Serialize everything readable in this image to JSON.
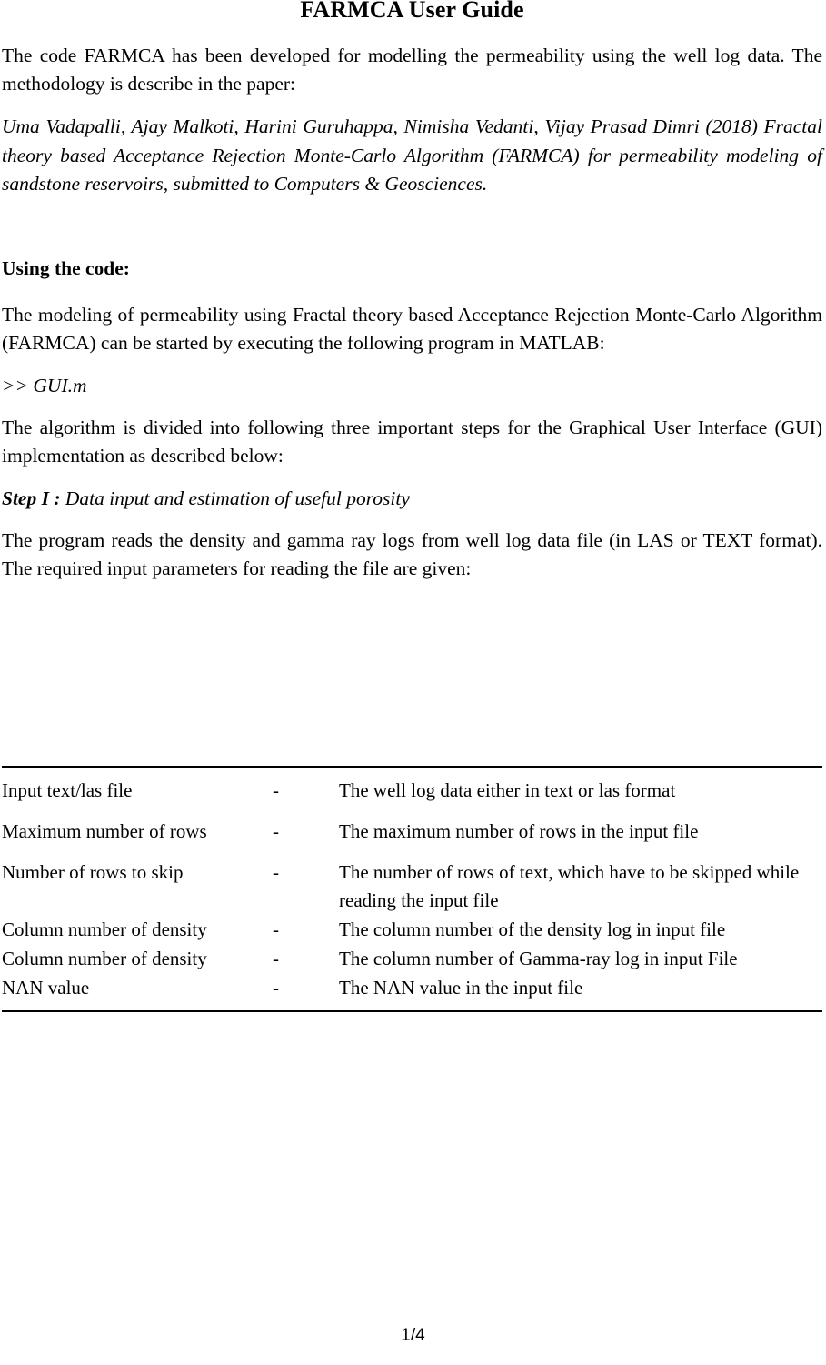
{
  "document": {
    "title": "FARMCA User Guide",
    "page_number": "1/4"
  },
  "intro": {
    "paragraph": "The code FARMCA has been developed for modelling the permeability using the well log data. The methodology is describe in the paper:"
  },
  "citation": {
    "text": "Uma Vadapalli, Ajay Malkoti, Harini Guruhappa, Nimisha Vedanti, Vijay Prasad Dimri (2018) Fractal theory based Acceptance Rejection Monte-Carlo Algorithm (FARMCA) for permeability modeling of sandstone reservoirs, submitted to Computers & Geosciences."
  },
  "using_the_code": {
    "heading": "Using the code:",
    "paragraph": "The modeling of permeability using Fractal theory based Acceptance Rejection Monte-Carlo Algorithm (FARMCA) can be started by executing the following program in MATLAB:",
    "command": ">> GUI.m",
    "algorithm_intro": " The algorithm is divided into following three important steps for the Graphical User Interface (GUI) implementation as described below:"
  },
  "step_one": {
    "label": "Step I : ",
    "title": "Data input and estimation of useful porosity",
    "description": "The program reads the density and gamma ray logs from well log data file (in LAS or TEXT format). The required input parameters for reading the file are given:"
  },
  "param_table": {
    "rows": [
      {
        "param": "Input text/las file",
        "dash": "-",
        "description": "The well log data either in text or las format"
      },
      {
        "param": "Maximum number of rows",
        "dash": "-",
        "description": "The maximum number of rows in the input file"
      },
      {
        "param": "Number of rows to skip",
        "dash": "-",
        "description": "The number of rows of text, which have to be skipped while reading the input file"
      },
      {
        "param": "Column number of density",
        "dash": "-",
        "description": "The column number of the density log in input file"
      },
      {
        "param": "Column number of density",
        "dash": "-",
        "description": "The column number of Gamma-ray log in input File"
      },
      {
        "param": "NAN value",
        "dash": "-",
        "description": "The NAN value in the input file"
      }
    ]
  }
}
